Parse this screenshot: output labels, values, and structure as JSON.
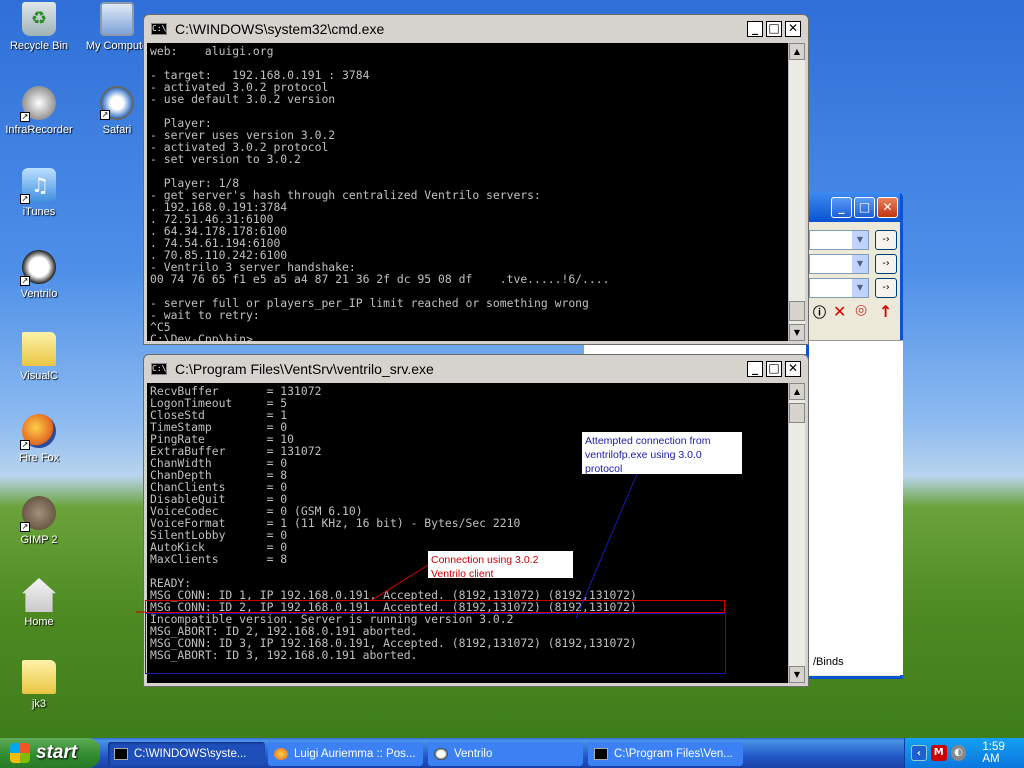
{
  "desktop": {
    "icons": [
      {
        "label": "Recycle Bin",
        "icon": "recycle-bin-icon"
      },
      {
        "label": "My Compute",
        "icon": "my-computer-icon"
      },
      {
        "label": "InfraRecorder",
        "icon": "infrarecorder-icon"
      },
      {
        "label": "Safari",
        "icon": "safari-icon"
      },
      {
        "label": "iTunes",
        "icon": "itunes-icon"
      },
      {
        "label": "Ventrilo",
        "icon": "ventrilo-icon"
      },
      {
        "label": "VisualC",
        "icon": "folder-icon"
      },
      {
        "label": "Fire Fox",
        "icon": "firefox-icon"
      },
      {
        "label": "GIMP 2",
        "icon": "gimp-icon"
      },
      {
        "label": "Home",
        "icon": "home-icon"
      },
      {
        "label": "jk3",
        "icon": "folder-icon"
      }
    ]
  },
  "cmd_window": {
    "title": "C:\\WINDOWS\\system32\\cmd.exe",
    "lines": [
      "web:    aluigi.org",
      "",
      "- target:   192.168.0.191 : 3784",
      "- activated 3.0.2 protocol",
      "- use default 3.0.2 version",
      "",
      "  Player:",
      "- server uses version 3.0.2",
      "- activated 3.0.2 protocol",
      "- set version to 3.0.2",
      "",
      "  Player: 1/8",
      "- get server's hash through centralized Ventrilo servers:",
      ". 192.168.0.191:3784",
      ". 72.51.46.31:6100",
      ". 64.34.178.178:6100",
      ". 74.54.61.194:6100",
      ". 70.85.110.242:6100",
      "- Ventrilo 3 server handshake:",
      "00 74 76 65 f1 e5 a5 a4 87 21 36 2f dc 95 08 df    .tve.....!6/....",
      "",
      "- server full or players_per_IP limit reached or something wrong",
      "- wait to retry:",
      "^C5",
      "C:\\Dev-Cpp\\bin>"
    ]
  },
  "srv_window": {
    "title": "C:\\Program Files\\VentSrv\\ventrilo_srv.exe",
    "lines": [
      "RecvBuffer       = 131072",
      "LogonTimeout     = 5",
      "CloseStd         = 1",
      "TimeStamp        = 0",
      "PingRate         = 10",
      "ExtraBuffer      = 131072",
      "ChanWidth        = 0",
      "ChanDepth        = 8",
      "ChanClients      = 0",
      "DisableQuit      = 0",
      "VoiceCodec       = 0 (GSM 6.10)",
      "VoiceFormat      = 1 (11 KHz, 16 bit) - Bytes/Sec 2210",
      "SilentLobby      = 0",
      "AutoKick         = 0",
      "MaxClients       = 8",
      "",
      "READY:",
      "MSG_CONN: ID 1, IP 192.168.0.191, Accepted. (8192,131072) (8192,131072)",
      "MSG_CONN: ID 2, IP 192.168.0.191, Accepted. (8192,131072) (8192,131072)",
      "Incompatible version. Server is running version 3.0.2",
      "MSG_ABORT: ID 2, 192.168.0.191 aborted.",
      "MSG_CONN: ID 3, IP 192.168.0.191, Accepted. (8192,131072) (8192,131072)",
      "MSG_ABORT: ID 3, 192.168.0.191 aborted."
    ]
  },
  "annotations": {
    "blue_note": "Attempted connection from ventrilofp.exe using 3.0.0 protocol",
    "red_note": "Connection using 3.0.2 Ventrilo client"
  },
  "ventrilo_bg": {
    "binds_label": "/Binds"
  },
  "taskbar": {
    "start_label": "start",
    "tasks": [
      {
        "label": "C:\\WINDOWS\\syste...",
        "icon": "console-icon",
        "active": true
      },
      {
        "label": "Luigi Auriemma :: Pos...",
        "icon": "firefox-icon",
        "active": false
      },
      {
        "label": "Ventrilo",
        "icon": "ventrilo-icon",
        "active": false
      },
      {
        "label": "C:\\Program Files\\Ven...",
        "icon": "console-icon",
        "active": false
      }
    ],
    "clock": "1:59 AM"
  },
  "colors": {
    "annotation_red": "#d00000",
    "annotation_blue": "#1a1ab0",
    "console_text": "#c0c0c0"
  }
}
